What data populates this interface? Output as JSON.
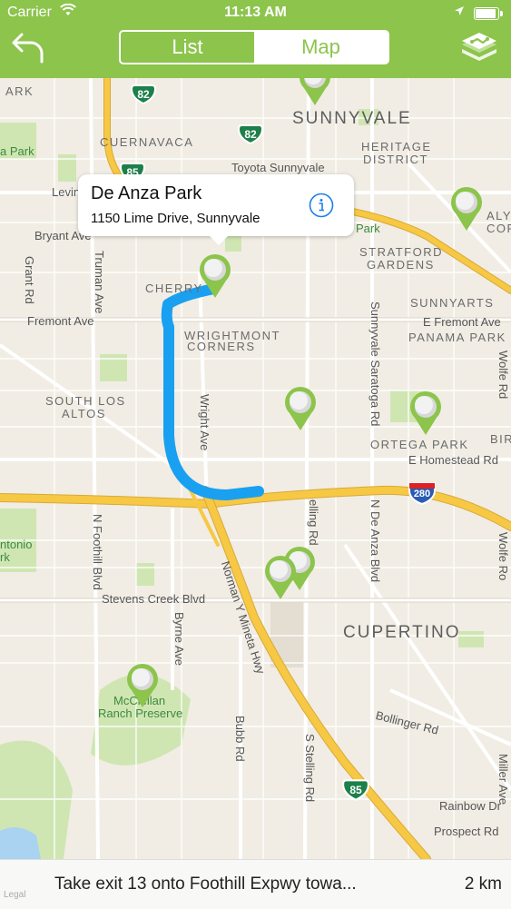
{
  "status_bar": {
    "carrier": "Carrier",
    "time": "11:13 AM"
  },
  "nav": {
    "tab_list": "List",
    "tab_map": "Map",
    "active_tab": "Map"
  },
  "callout": {
    "title": "De Anza Park",
    "address": "1150 Lime Drive, Sunnyvale"
  },
  "map_labels": {
    "sunnyvale": "SUNNYVALE",
    "cuernavaca": "CUERNAVACA",
    "heritage": "HERITAGE",
    "district": "DISTRICT",
    "toyota": "Toyota Sunnyvale",
    "levin": "Levin",
    "bryant": "Bryant Ave",
    "a_park": "a Park",
    "park_partial": "ARK",
    "park_small": "Park",
    "valy": "ALY",
    "cor": "COR",
    "stratford": "STRATFORD",
    "gardens": "GARDENS",
    "cherry": "CHERRY",
    "sunnyarts": "SUNNYARTS",
    "fremont_w": "Fremont Ave",
    "fremont_e": "E Fremont Ave",
    "panama": "PANAMA PARK",
    "wrightmont": "WRIGHTMONT",
    "corners": "CORNERS",
    "south_los": "SOUTH LOS",
    "altos": "ALTOS",
    "ortega": "ORTEGA PARK",
    "bir": "BIR",
    "homestead": "E Homestead Rd",
    "antonio": "ntonio",
    "rk": "rk",
    "stevens": "Stevens Creek Blvd",
    "cupertino": "CUPERTINO",
    "mcclellan": "McClellan",
    "ranch": "Ranch Preserve",
    "bollinger": "Bollinger Rd",
    "rainbow": "Rainbow Dr",
    "prospect": "Prospect Rd",
    "grant": "Grant Rd",
    "truman": "Truman Ave",
    "wright": "Wright Ave",
    "saratoga": "Sunnyvale Saratoga Rd",
    "stelling": "S Stelling Rd",
    "stelling2": "elling Rd",
    "de_anza": "N De Anza Blvd",
    "foothill": "N Foothill Blvd",
    "byrne": "Byrne Ave",
    "mineta": "Norman Y Mineta Hwy",
    "bubb": "Bubb Rd",
    "miller": "Miller Ave",
    "wolfe": "Wolfe Rd",
    "wolfe2": "Wolfe Ro",
    "shield_82a": "82",
    "shield_82b": "82",
    "shield_85a": "85",
    "shield_85b": "85",
    "shield_280": "280"
  },
  "bottom_bar": {
    "instruction": "Take exit 13 onto Foothill Expwy towa...",
    "distance": "2 km",
    "legal": "Legal"
  },
  "colors": {
    "accent": "#8cc44c",
    "route": "#1aa0f0",
    "highway": "#f7c843",
    "park": "#cfe6b3"
  }
}
